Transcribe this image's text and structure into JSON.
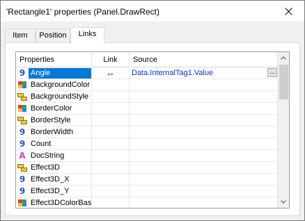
{
  "window": {
    "title": "'Rectangle1' properties (Panel.DrawRect)"
  },
  "tabs": [
    {
      "label": "Item"
    },
    {
      "label": "Position"
    },
    {
      "label": "Links"
    }
  ],
  "grid": {
    "headers": {
      "properties": "Properties",
      "link": "Link",
      "source": "Source"
    },
    "rows": [
      {
        "icon": "number-icon",
        "name": "Angle",
        "link": "↔",
        "source": "Data.InternalTag1.Value",
        "ellipsis": "..."
      },
      {
        "icon": "color-icon",
        "name": "BackgroundColor",
        "link": "",
        "source": ""
      },
      {
        "icon": "style-icon",
        "name": "BackgroundStyle",
        "link": "",
        "source": ""
      },
      {
        "icon": "color-icon",
        "name": "BorderColor",
        "link": "",
        "source": ""
      },
      {
        "icon": "style-icon",
        "name": "BorderStyle",
        "link": "",
        "source": ""
      },
      {
        "icon": "number-icon",
        "name": "BorderWidth",
        "link": "",
        "source": ""
      },
      {
        "icon": "number-icon",
        "name": "Count",
        "link": "",
        "source": ""
      },
      {
        "icon": "text-icon",
        "name": "DocString",
        "link": "",
        "source": ""
      },
      {
        "icon": "style-icon",
        "name": "Effect3D",
        "link": "",
        "source": ""
      },
      {
        "icon": "number-icon",
        "name": "Effect3D_X",
        "link": "",
        "source": ""
      },
      {
        "icon": "number-icon",
        "name": "Effect3D_Y",
        "link": "",
        "source": ""
      },
      {
        "icon": "color-icon",
        "name": "Effect3DColorBas",
        "link": "",
        "source": ""
      }
    ]
  },
  "icon_glyphs": {
    "number": "9",
    "text": "A"
  },
  "colors": {
    "selection": "#0078d7",
    "link_text": "#0033cc",
    "number_icon": "#2456c7",
    "text_icon": "#d639c9"
  }
}
